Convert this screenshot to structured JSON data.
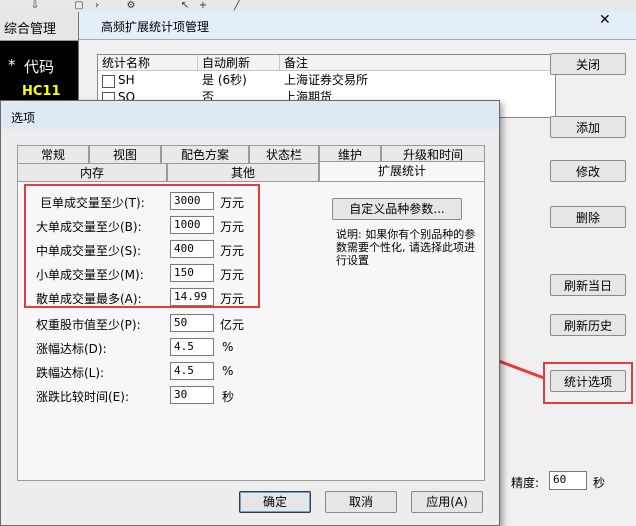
{
  "toolbar": {
    "icons": [
      "arrow-down-icon",
      "window-icon",
      "chevron-icon",
      "gear-icon",
      "cursor-icon",
      "cross-icon",
      "line-icon"
    ]
  },
  "left_panel": {
    "tab_label": "综合管理",
    "header_star": "*",
    "header_code": "代码",
    "first_code": "HC11"
  },
  "back_dialog": {
    "title": "高频扩展统计项管理",
    "close_glyph": "✕",
    "columns": [
      "统计名称",
      "自动刷新",
      "备注"
    ],
    "rows": [
      {
        "name": "SH",
        "refresh": "是 (6秒)",
        "note": "上海证券交易所"
      },
      {
        "name": "SQ",
        "refresh": "否",
        "note": "上海期货"
      }
    ],
    "buttons": {
      "close": "关闭",
      "add": "添加",
      "modify": "修改",
      "delete": "删除",
      "refresh_today": "刷新当日",
      "refresh_history": "刷新历史",
      "stat_options": "统计选项"
    },
    "precision_label": "精度:",
    "precision_value": "60",
    "precision_unit": "秒"
  },
  "options_dialog": {
    "title": "选项",
    "tabs_row1": [
      "常规",
      "视图",
      "配色方案",
      "状态栏",
      "维护",
      "升级和时间"
    ],
    "tabs_row2": [
      "内存",
      "其他",
      "扩展统计"
    ],
    "active_tab": "扩展统计",
    "fields": [
      {
        "label": "巨单成交量至少(T):",
        "value": "3000",
        "unit": "万元"
      },
      {
        "label": "大单成交量至少(B):",
        "value": "1000",
        "unit": "万元"
      },
      {
        "label": "中单成交量至少(S):",
        "value": "400",
        "unit": "万元"
      },
      {
        "label": "小单成交量至少(M):",
        "value": "150",
        "unit": "万元"
      },
      {
        "label": "散单成交量最多(A):",
        "value": "14.99",
        "unit": "万元"
      },
      {
        "label": "权重股市值至少(P):",
        "value": "50",
        "unit": "亿元"
      },
      {
        "label": "涨幅达标(D):",
        "value": "4.5",
        "unit": "%"
      },
      {
        "label": "跌幅达标(L):",
        "value": "4.5",
        "unit": "%"
      },
      {
        "label": "涨跌比较时间(E):",
        "value": "30",
        "unit": "秒"
      }
    ],
    "custom_button": "自定义品种参数...",
    "note": "说明: 如果你有个别品种的参数需要个性化, 请选择此项进行设置",
    "ok": "确定",
    "cancel": "取消",
    "apply": "应用(A)"
  },
  "highlight_color": "#e53b3b"
}
